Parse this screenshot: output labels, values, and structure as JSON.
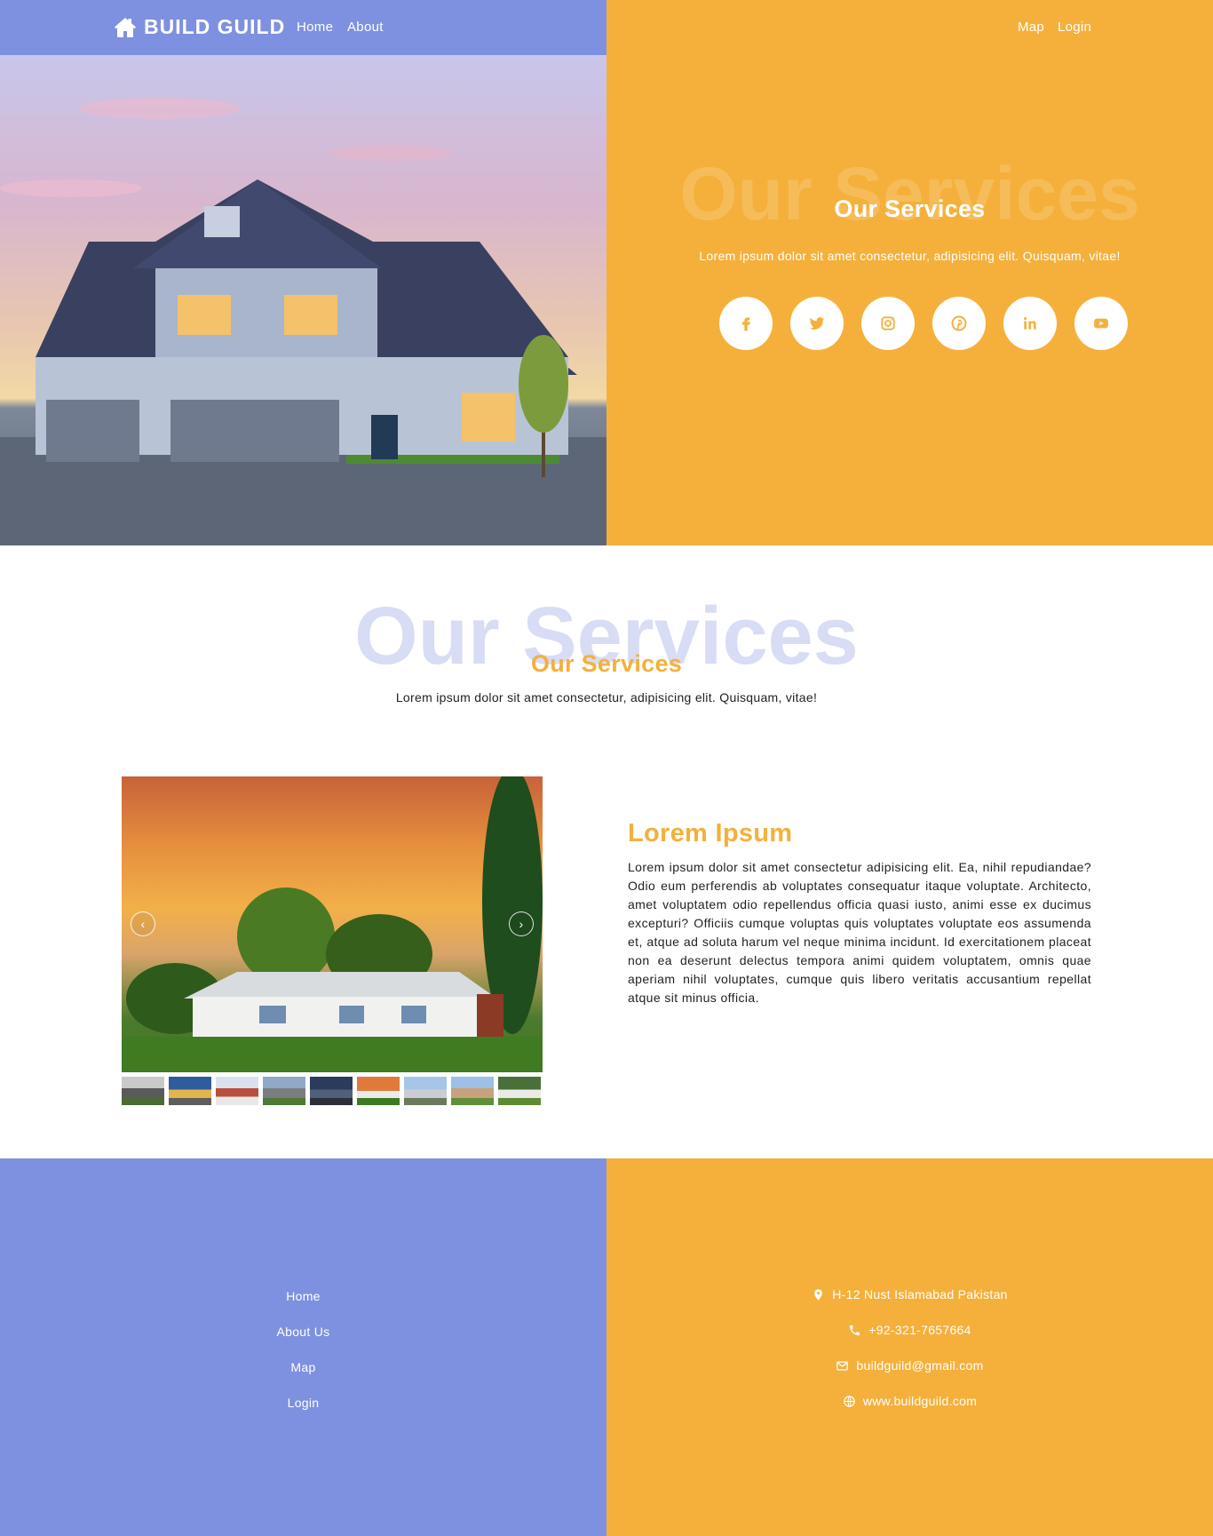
{
  "nav": {
    "brand": "BUILD GUILD",
    "links": {
      "home": "Home",
      "about": "About",
      "map": "Map",
      "login": "Login"
    }
  },
  "hero": {
    "ghost_title": "Our Services",
    "title": "Our Services",
    "subtitle": "Lorem ipsum dolor sit amet consectetur, adipisicing elit. Quisquam, vitae!",
    "socials": [
      "facebook-icon",
      "twitter-icon",
      "instagram-icon",
      "pinterest-icon",
      "linkedin-icon",
      "youtube-icon"
    ]
  },
  "services": {
    "ghost_title": "Our Services",
    "title": "Our Services",
    "subtitle": "Lorem ipsum dolor sit amet consectetur, adipisicing elit. Quisquam, vitae!"
  },
  "feature": {
    "title": "Lorem Ipsum",
    "body": "Lorem ipsum dolor sit amet consectetur adipisicing elit. Ea, nihil repudiandae? Odio eum perferendis ab voluptates consequatur itaque voluptate. Architecto, amet voluptatem odio repellendus officia quasi iusto, animi esse ex ducimus excepturi? Officiis cumque voluptas quis voluptates voluptate eos assumenda et, atque ad soluta harum vel neque minima incidunt. Id exercitationem placeat non ea deserunt delectus tempora animi quidem voluptatem, omnis quae aperiam nihil voluptates, cumque quis libero veritatis accusantium repellat atque sit minus officia."
  },
  "footer": {
    "links": [
      "Home",
      "About Us",
      "Map",
      "Login"
    ],
    "contact": {
      "address": "H-12 Nust Islamabad Pakistan",
      "phone": "+92-321-7657664",
      "email": "buildguild@gmail.com",
      "website": "www.buildguild.com"
    }
  },
  "colors": {
    "blue": "#7e91e0",
    "orange": "#f5b03b",
    "ghost": "#d8dcf5"
  }
}
